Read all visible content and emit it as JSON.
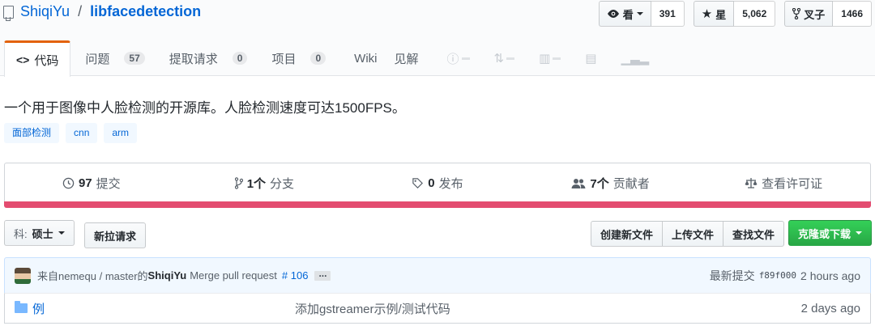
{
  "repo": {
    "owner": "ShiqiYu",
    "separator": "/",
    "name": "libfacedetection"
  },
  "actions": {
    "watch": {
      "label": "看",
      "count": "391"
    },
    "star": {
      "label": "星",
      "count": "5,062"
    },
    "fork": {
      "label": "叉子",
      "count": "1466"
    }
  },
  "tabs": [
    {
      "label": "代码",
      "icon": "code-icon"
    },
    {
      "label": "问题",
      "count": "57"
    },
    {
      "label": "提取请求",
      "count": "0"
    },
    {
      "label": "项目",
      "count": "0"
    },
    {
      "label": "Wiki"
    },
    {
      "label": "见解"
    }
  ],
  "description": "一个用于图像中人脸检测的开源库。人脸检测速度可达1500FPS。",
  "topics": [
    "面部检测",
    "cnn",
    "arm"
  ],
  "summary": {
    "commits": {
      "count": "97",
      "label": "提交"
    },
    "branches": {
      "count": "1个",
      "label": "分支"
    },
    "releases": {
      "count": "0",
      "label": "发布"
    },
    "contributors": {
      "count": "7个",
      "label": "贡献者"
    },
    "license": {
      "label": "查看许可证"
    }
  },
  "language_bar_color": "#e34c70",
  "file_nav": {
    "branch_label": "科:",
    "branch_value": "硕士",
    "new_pr": "新拉请求",
    "create_file": "创建新文件",
    "upload_files": "上传文件",
    "find_file": "查找文件",
    "clone": "克隆或下载"
  },
  "commit": {
    "from": "来自nemequ / master的",
    "author": "ShiqiYu",
    "message": "Merge pull request",
    "pr": "# 106",
    "expander": "...",
    "latest_label": "最新提交",
    "sha": "f89f000",
    "age": "2 hours ago"
  },
  "files": [
    {
      "name": "例",
      "message": "添加gstreamer示例/测试代码",
      "age": "2 days ago"
    }
  ]
}
